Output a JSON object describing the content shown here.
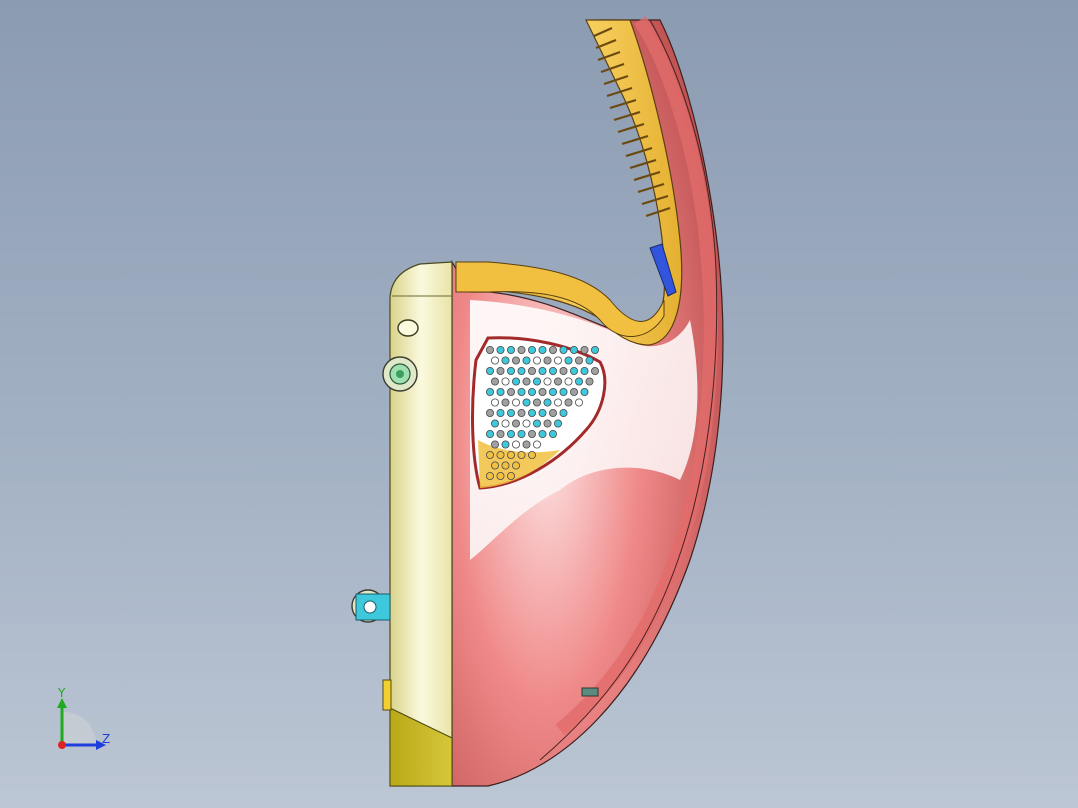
{
  "viewport": {
    "background_top": "#8b9bb1",
    "background_bottom": "#bcc6d4"
  },
  "model": {
    "body_color": "#f08a8a",
    "handle_color": "#f2c040",
    "cap_color": "#f0eec0",
    "trigger_color": "#3355dd",
    "clip_color": "#3ec8dc",
    "vent_hole_colors": [
      "#3ec8dc",
      "#a0a0a0",
      "#ffffff",
      "#f2c040"
    ]
  },
  "triad": {
    "y_label": "Y",
    "z_label": "Z",
    "y_color": "#1faa1f",
    "z_color": "#1f3fdd",
    "x_color": "#dd2222"
  }
}
